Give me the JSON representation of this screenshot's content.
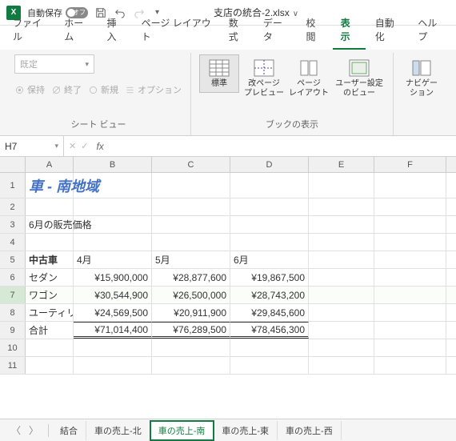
{
  "titlebar": {
    "autosave_label": "自動保存",
    "autosave_state": "オフ",
    "filename": "支店の統合-2.xlsx"
  },
  "tabs": {
    "items": [
      "ファイル",
      "ホーム",
      "挿入",
      "ページ レイアウト",
      "数式",
      "データ",
      "校閲",
      "表示",
      "自動化",
      "ヘルプ"
    ],
    "active_index": 7
  },
  "ribbon": {
    "group1": {
      "dropdown": "既定",
      "btn_keep": "保持",
      "btn_exit": "終了",
      "btn_new": "新規",
      "btn_options": "オプション",
      "label": "シート ビュー"
    },
    "group2": {
      "btns": [
        {
          "label": "標準"
        },
        {
          "label": "改ページ\nプレビュー"
        },
        {
          "label": "ページ\nレイアウト"
        },
        {
          "label": "ユーザー設定\nのビュー"
        }
      ],
      "label": "ブックの表示"
    },
    "group3": {
      "btn": "ナビゲー\nション"
    }
  },
  "namebox": "H7",
  "colheads": [
    "A",
    "B",
    "C",
    "D",
    "E",
    "F"
  ],
  "rowheads": [
    "1",
    "2",
    "3",
    "4",
    "5",
    "6",
    "7",
    "8",
    "9",
    "10",
    "11"
  ],
  "cells": {
    "title": "車 - 南地域",
    "a3": "6月の販売価格",
    "a5": "中古車",
    "b5": "4月",
    "c5": "5月",
    "d5": "6月",
    "a6": "セダン",
    "b6": "¥15,900,000",
    "c6": "¥28,877,600",
    "d6": "¥19,867,500",
    "a7": "ワゴン",
    "b7": "¥30,544,900",
    "c7": "¥26,500,000",
    "d7": "¥28,743,200",
    "a8": "ユーティリ",
    "b8": "¥24,569,500",
    "c8": "¥20,911,900",
    "d8": "¥29,845,600",
    "a9": "合計",
    "b9": "¥71,014,400",
    "c9": "¥76,289,500",
    "d9": "¥78,456,300"
  },
  "sheets": {
    "items": [
      "結合",
      "車の売上-北",
      "車の売上-南",
      "車の売上-東",
      "車の売上-西"
    ],
    "active_index": 2
  }
}
